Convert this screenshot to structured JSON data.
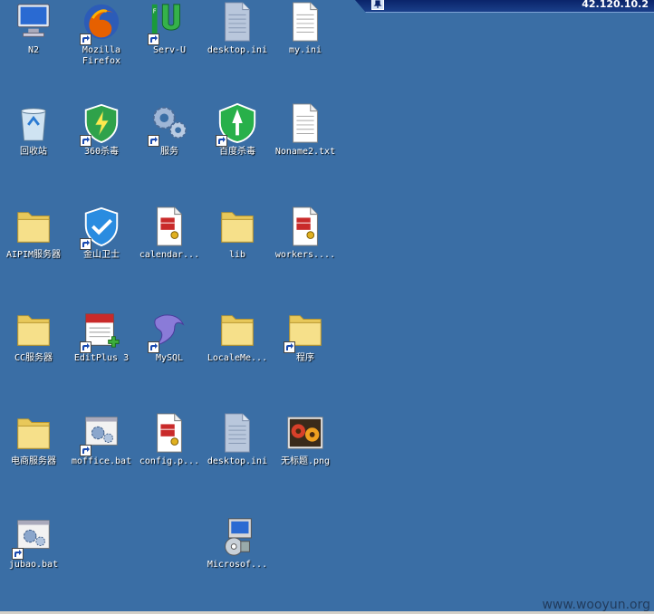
{
  "window_bar": {
    "ip_text": "42.120.10.2"
  },
  "watermark": "www.wooyun.org",
  "desktop_icons": [
    {
      "label": "N2",
      "icon": "computer-icon",
      "shortcut": false
    },
    {
      "label": "Mozilla\nFirefox",
      "icon": "firefox-icon",
      "shortcut": true
    },
    {
      "label": "Serv-U",
      "icon": "servu-icon",
      "shortcut": true
    },
    {
      "label": "desktop.ini",
      "icon": "ini-file-icon",
      "shortcut": false
    },
    {
      "label": "my.ini",
      "icon": "text-file-icon",
      "shortcut": false
    },
    {
      "label": "回收站",
      "icon": "recycle-bin-icon",
      "shortcut": false
    },
    {
      "label": "360杀毒",
      "icon": "shield-green-icon",
      "shortcut": true
    },
    {
      "label": "服务",
      "icon": "gears-icon",
      "shortcut": true
    },
    {
      "label": "百度杀毒",
      "icon": "baidu-antivirus-icon",
      "shortcut": true
    },
    {
      "label": "Noname2.txt",
      "icon": "text-file-icon",
      "shortcut": false
    },
    {
      "label": "AIPIM服务器",
      "icon": "folder-icon",
      "shortcut": false
    },
    {
      "label": "金山卫士",
      "icon": "shield-blue-icon",
      "shortcut": true
    },
    {
      "label": "calendar...",
      "icon": "script-file-icon",
      "shortcut": false
    },
    {
      "label": "lib",
      "icon": "folder-icon",
      "shortcut": false
    },
    {
      "label": "workers....",
      "icon": "script-file-icon",
      "shortcut": false
    },
    {
      "label": "CC服务器",
      "icon": "folder-icon",
      "shortcut": false
    },
    {
      "label": "EditPlus 3",
      "icon": "editplus-icon",
      "shortcut": true
    },
    {
      "label": "MySQL",
      "icon": "mysql-icon",
      "shortcut": true
    },
    {
      "label": "LocaleMe...",
      "icon": "folder-icon",
      "shortcut": false
    },
    {
      "label": "程序",
      "icon": "folder-icon",
      "shortcut": true
    },
    {
      "label": "电商服务器",
      "icon": "folder-icon",
      "shortcut": false
    },
    {
      "label": "moffice.bat",
      "icon": "batch-file-icon",
      "shortcut": true
    },
    {
      "label": "config.p...",
      "icon": "script-file-icon",
      "shortcut": false
    },
    {
      "label": "desktop.ini",
      "icon": "ini-file-icon",
      "shortcut": false
    },
    {
      "label": "无标题.png",
      "icon": "image-file-icon",
      "shortcut": false
    },
    {
      "label": "jubao.bat",
      "icon": "batch-file-icon",
      "shortcut": true
    },
    {
      "label": "Microsof...",
      "icon": "installer-icon",
      "shortcut": false
    }
  ]
}
